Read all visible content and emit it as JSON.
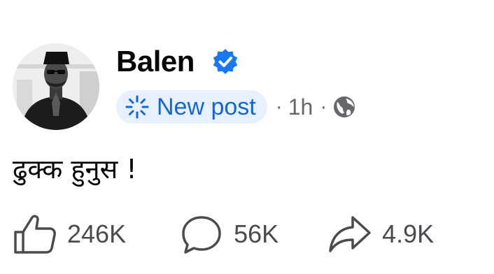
{
  "post": {
    "author": {
      "name": "Balen",
      "verified": true,
      "verified_color": "#1877f2"
    },
    "meta": {
      "badge_label": "New post",
      "badge_icon": "sparkle-icon",
      "badge_color": "#1665d8",
      "badge_bg": "#e7f0fd",
      "separator": "·",
      "time": "1h",
      "audience_icon": "globe-icon"
    },
    "text": "ढुक्क हुनुस !",
    "reactions": {
      "likes": "246K",
      "comments": "56K",
      "shares": "4.9K"
    }
  }
}
